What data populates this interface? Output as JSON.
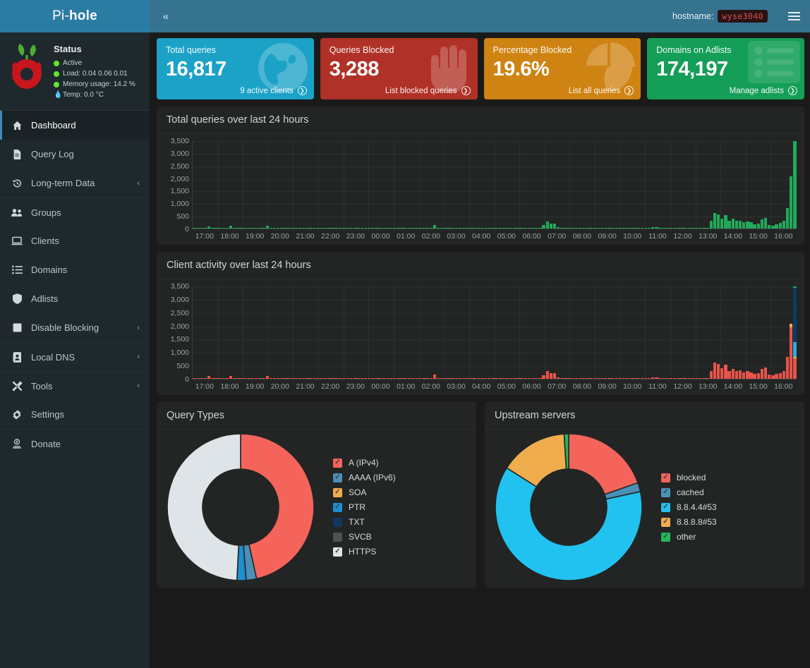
{
  "topbar": {
    "brand_thin": "Pi-",
    "brand_bold": "hole",
    "collapse_icon": "chevron-double-left",
    "hostname_label": "hostname:",
    "hostname_value": "wyse3040"
  },
  "sidebar": {
    "status": {
      "title": "Status",
      "active": "Active",
      "load": "Load:  0.04  0.06  0.01",
      "memory": "Memory usage:  14.2 %",
      "temp": "Temp: 0.0 °C"
    },
    "items": [
      {
        "label": "Dashboard",
        "icon": "home-icon",
        "active": true,
        "caret": ""
      },
      {
        "label": "Query Log",
        "icon": "file-icon",
        "active": false,
        "caret": ""
      },
      {
        "label": "Long-term Data",
        "icon": "history-icon",
        "active": false,
        "caret": "‹"
      },
      {
        "label": "Groups",
        "icon": "users-icon",
        "active": false,
        "caret": ""
      },
      {
        "label": "Clients",
        "icon": "laptop-icon",
        "active": false,
        "caret": ""
      },
      {
        "label": "Domains",
        "icon": "list-icon",
        "active": false,
        "caret": ""
      },
      {
        "label": "Adlists",
        "icon": "shield-icon",
        "active": false,
        "caret": ""
      },
      {
        "label": "Disable Blocking",
        "icon": "square-icon",
        "active": false,
        "caret": "‹"
      },
      {
        "label": "Local DNS",
        "icon": "address-icon",
        "active": false,
        "caret": "‹"
      },
      {
        "label": "Tools",
        "icon": "tools-icon",
        "active": false,
        "caret": "‹"
      },
      {
        "label": "Settings",
        "icon": "gear-icon",
        "active": false,
        "caret": ""
      },
      {
        "label": "Donate",
        "icon": "donate-icon",
        "active": false,
        "caret": ""
      }
    ]
  },
  "cards": [
    {
      "title": "Total queries",
      "value": "16,817",
      "foot": "9 active clients",
      "color": "#1ba2c6",
      "icon": "globe-icon"
    },
    {
      "title": "Queries Blocked",
      "value": "3,288",
      "foot": "List blocked queries",
      "color": "#b03127",
      "icon": "hand-icon"
    },
    {
      "title": "Percentage Blocked",
      "value": "19.6%",
      "foot": "List all queries",
      "color": "#cf8312",
      "icon": "pie-icon"
    },
    {
      "title": "Domains on Adlists",
      "value": "174,197",
      "foot": "Manage adlists",
      "color": "#149e57",
      "icon": "adlist-icon"
    }
  ],
  "chart_data": [
    {
      "type": "bar",
      "title": "Total queries over last 24 hours",
      "xlabel": "",
      "ylabel": "",
      "ylim": [
        0,
        3500
      ],
      "yticks": [
        3500,
        3000,
        2500,
        2000,
        1500,
        1000,
        500,
        0
      ],
      "ytick_labels": [
        "3,500",
        "3,000",
        "2,500",
        "2,000",
        "1,500",
        "1,000",
        "500",
        "0"
      ],
      "grid": true,
      "x": [
        "17:00",
        "18:00",
        "19:00",
        "20:00",
        "21:00",
        "22:00",
        "23:00",
        "00:00",
        "01:00",
        "02:00",
        "03:00",
        "04:00",
        "05:00",
        "06:00",
        "07:00",
        "08:00",
        "09:00",
        "10:00",
        "11:00",
        "12:00",
        "13:00",
        "14:00",
        "15:00",
        "16:00"
      ],
      "series": [
        {
          "name": "permitted",
          "color": "#22a95b",
          "values": [
            12,
            18,
            22,
            30,
            95,
            20,
            24,
            18,
            26,
            30,
            118,
            22,
            18,
            16,
            20,
            24,
            14,
            18,
            22,
            26,
            118,
            20,
            18,
            16,
            12,
            18,
            22,
            16,
            14,
            18,
            20,
            14,
            16,
            18,
            12,
            14,
            18,
            22,
            16,
            14,
            18,
            20,
            16,
            14,
            12,
            16,
            18,
            14,
            20,
            16,
            18,
            22,
            14,
            16,
            18,
            20,
            14,
            12,
            16,
            18,
            22,
            20,
            16,
            14,
            18,
            12,
            150,
            26,
            18,
            14,
            16,
            18,
            20,
            14,
            12,
            16,
            18,
            14,
            16,
            18,
            20,
            14,
            12,
            16,
            18,
            20,
            16,
            14,
            12,
            18,
            20,
            16,
            18,
            14,
            16,
            20,
            130,
            280,
            210,
            200,
            60,
            26,
            18,
            16,
            14,
            12,
            16,
            18,
            14,
            12,
            16,
            18,
            20,
            14,
            12,
            16,
            18,
            20,
            14,
            16,
            12,
            18,
            14,
            20,
            16,
            40,
            60,
            55,
            30,
            22,
            18,
            16,
            14,
            20,
            18,
            22,
            16,
            14,
            18,
            20,
            16,
            14,
            300,
            620,
            560,
            390,
            520,
            300,
            380,
            300,
            320,
            250,
            290,
            240,
            180,
            200,
            360,
            420,
            150,
            120,
            180,
            220,
            300,
            820,
            2080,
            3480
          ]
        }
      ]
    },
    {
      "type": "bar",
      "stacked": true,
      "title": "Client activity over last 24 hours",
      "xlabel": "",
      "ylabel": "",
      "ylim": [
        0,
        3500
      ],
      "yticks": [
        3500,
        3000,
        2500,
        2000,
        1500,
        1000,
        500,
        0
      ],
      "ytick_labels": [
        "3,500",
        "3,000",
        "2,500",
        "2,000",
        "1,500",
        "1,000",
        "500",
        "0"
      ],
      "grid": true,
      "x": [
        "17:00",
        "18:00",
        "19:00",
        "20:00",
        "21:00",
        "22:00",
        "23:00",
        "00:00",
        "01:00",
        "02:00",
        "03:00",
        "04:00",
        "05:00",
        "06:00",
        "07:00",
        "08:00",
        "09:00",
        "10:00",
        "11:00",
        "12:00",
        "13:00",
        "14:00",
        "15:00",
        "16:00"
      ],
      "legend_colors": [
        "#e8534a",
        "#f0ad4e",
        "#29abe0",
        "#0b3c69",
        "#22a95b"
      ]
    }
  ],
  "panels": {
    "total_queries_title": "Total queries over last 24 hours",
    "client_activity_title": "Client activity over last 24 hours",
    "query_types_title": "Query Types",
    "upstream_title": "Upstream servers"
  },
  "query_types": {
    "type": "pie",
    "title": "Query Types",
    "labels": [
      "A (IPv4)",
      "AAAA (IPv6)",
      "SOA",
      "PTR",
      "TXT",
      "SVCB",
      "HTTPS"
    ],
    "values": [
      46.5,
      2.3,
      0.0,
      2.0,
      0.0,
      0.0,
      49.2
    ],
    "colors": [
      "#f4645a",
      "#4a90b8",
      "#f0ad4e",
      "#1e8fd0",
      "#0b3c69",
      "#555a5c",
      "#dfe4e8"
    ],
    "checked": [
      true,
      true,
      true,
      true,
      false,
      false,
      true
    ]
  },
  "upstream_servers": {
    "type": "pie",
    "title": "Upstream servers",
    "labels": [
      "blocked",
      "cached",
      "8.8.4.4#53",
      "8.8.8.8#53",
      "other"
    ],
    "values": [
      19.6,
      2.0,
      62.4,
      15.0,
      1.0
    ],
    "colors": [
      "#f4645a",
      "#4a90b8",
      "#22c2f0",
      "#f0ad4e",
      "#22b85c"
    ],
    "checked": [
      true,
      true,
      true,
      true,
      true
    ]
  }
}
